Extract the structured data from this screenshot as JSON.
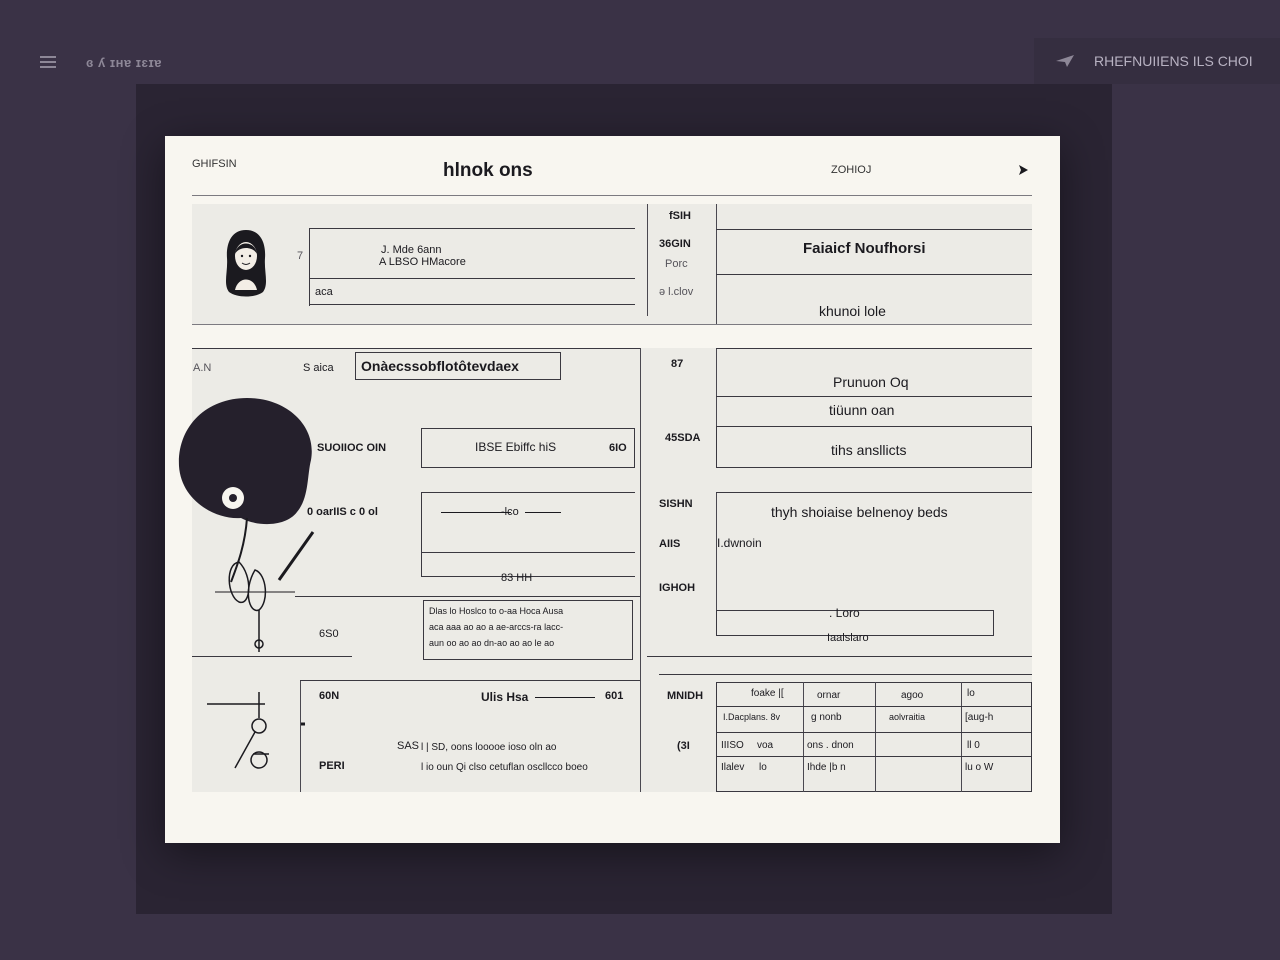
{
  "topbar": {
    "menu_icon": "hamburger-icon",
    "title": "ɞ ʎ ɪʜɐ ɪɛɪɐ",
    "share_icon": "send-icon",
    "right_text": "RHEFNUIIENS ILS CHOI"
  },
  "document": {
    "header_left": "GHIFSIN",
    "title": "hlnok ons",
    "zoom": "ZOHIOJ",
    "next_icon": "chevron-right-icon",
    "profile": {
      "avatar_icon": "person-avatar-icon",
      "lines": [
        "J. Mde 6ann",
        "A LBSO HMacore",
        "aca"
      ],
      "row_marker": "7"
    },
    "mid_labels_1": [
      "fSIH",
      "36GIN",
      "Porc",
      "ǝ l.clov"
    ],
    "name_title": "Faiaicf Noufhorsi",
    "subname": "khunoi lole",
    "section2": {
      "left_tag": "A.N",
      "label": "S aica",
      "heading": "Onàecssobflotôtevdaex",
      "row_label_1": "SUOIIOC OIN",
      "row_value_1": "IBSE Ebiffc hiS",
      "row_unit_1": "6IO",
      "row_label_2": "0 oarIIS c 0 ol",
      "slider_label": "-lco",
      "caption": "83 HH",
      "note_label": "6S0",
      "note_lines": [
        "Dlas lo Hoslco to o-aa Hoca Ausa",
        "aca aaa ao ao a ae-arccs-ra lacc-",
        "aun oo ao ao dn-ao ao ao le ao"
      ]
    },
    "mid_labels_2": [
      "87",
      "45SDA",
      "SISHN",
      "AIIS",
      "IGHOH"
    ],
    "right_items": [
      "Prunuon Oq",
      "tiüunn oan",
      "tihs ansllicts"
    ],
    "right_desc": "thyh shoiaise  belnenoy beds",
    "right_sub": "I.dwnoin",
    "right_field": ". Loro",
    "right_field_caption": "Iaalslaro",
    "section3": {
      "label_1": "60N",
      "value_1": "Ulis Hsa",
      "unit_1": "601",
      "label_2": "SAS",
      "label_3": "PERI",
      "text_lines": [
        "l | SD, oons looooe ioso oln ao",
        "l io oun Qi clso cetuflan oscllcco boeo"
      ]
    },
    "table": {
      "row_labels": [
        "MNIDH",
        "(3I"
      ],
      "rows": [
        [
          "foake |[",
          "ornar",
          "agoo",
          "lo"
        ],
        [
          "I.Dacplans. 8v",
          "g  nonb",
          "aolvraitia",
          "[aug-h"
        ],
        [
          "IIISO",
          "voa",
          "ons . dnon",
          "ll  0"
        ],
        [
          "Ilalev",
          "lo",
          "Ihde |b n",
          "lu o W"
        ]
      ]
    }
  }
}
